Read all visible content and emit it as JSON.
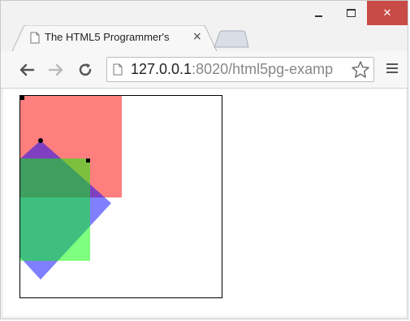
{
  "window": {
    "controls": {
      "minimize_icon": "minimize-icon",
      "maximize_icon": "maximize-icon",
      "close_label": "✕",
      "close_color": "#c94b47"
    }
  },
  "tab": {
    "title": "The HTML5 Programmer's",
    "close_label": "×",
    "icon": "page-icon"
  },
  "toolbar": {
    "back_icon": "arrow-left-icon",
    "forward_icon": "arrow-right-icon",
    "reload_icon": "reload-icon",
    "menu_icon": "hamburger-menu-icon",
    "star_icon": "star-icon"
  },
  "address": {
    "host": "127.0.0.1",
    "path": ":8020/html5pg-examp"
  },
  "canvas": {
    "shapes": [
      {
        "name": "red-square",
        "color": "#ff0000",
        "opacity": 0.5
      },
      {
        "name": "blue-diamond",
        "color": "#0000ff",
        "opacity": 0.5
      },
      {
        "name": "green-square",
        "color": "#00ff00",
        "opacity": 0.5
      }
    ],
    "marker_color": "#000000"
  }
}
